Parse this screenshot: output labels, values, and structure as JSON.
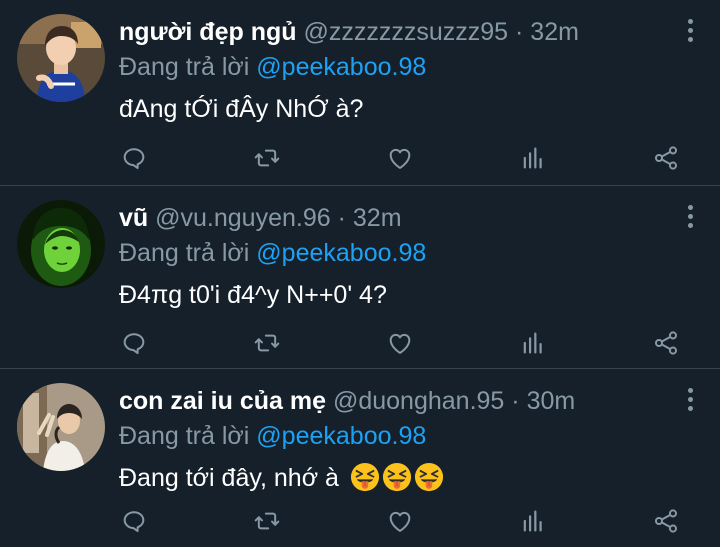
{
  "tweets": [
    {
      "name": "người đẹp ngủ",
      "handle": "@zzzzzzzsuzzz95",
      "separator": "·",
      "time": "32m",
      "reply_prefix": "Đang trả lời",
      "reply_to": "@peekaboo.98",
      "text": "đAng tỚi đÂy NhỚ à?",
      "emojis": []
    },
    {
      "name": "vũ",
      "handle": "@vu.nguyen.96",
      "separator": "·",
      "time": "32m",
      "reply_prefix": "Đang trả lời",
      "reply_to": "@peekaboo.98",
      "text": "Đ4πg t0'i đ4^y N++0' 4?",
      "emojis": []
    },
    {
      "name": "con zai iu của mẹ",
      "handle": "@duonghan.95",
      "separator": "·",
      "time": "30m",
      "reply_prefix": "Đang trả lời",
      "reply_to": "@peekaboo.98",
      "text": "Đang tới đây, nhớ à",
      "emojis": [
        "squinting-face-with-tongue",
        "squinting-face-with-tongue",
        "squinting-face-with-tongue"
      ]
    }
  ],
  "icons": {
    "reply": "reply-icon",
    "retweet": "retweet-icon",
    "like": "heart-icon",
    "stats": "stats-icon",
    "share": "share-icon",
    "more": "more-icon"
  },
  "colors": {
    "background": "#15202b",
    "divider": "#38444d",
    "secondary_text": "#8899a6",
    "mention": "#1da1f2"
  }
}
